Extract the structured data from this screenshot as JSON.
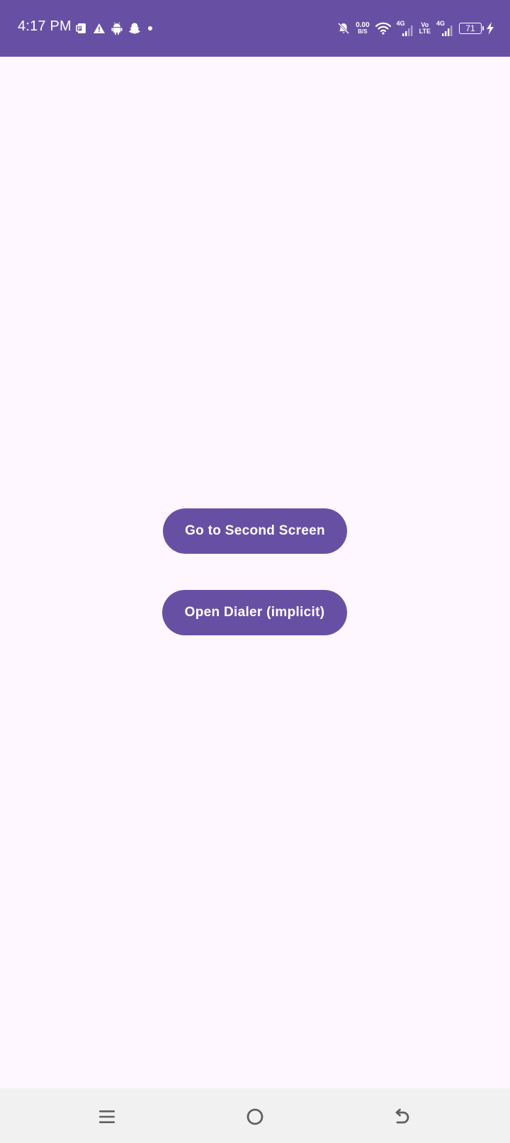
{
  "status_bar": {
    "time": "4:17 PM",
    "net_speed_value": "0.00",
    "net_speed_unit": "B/S",
    "sim1_network": "4G",
    "volte_top": "Vo",
    "volte_bottom": "LTE",
    "sim2_network": "4G",
    "battery_level": "71",
    "icons": [
      "pdf-icon",
      "warning-icon",
      "android-icon",
      "snapchat-icon",
      "dot-icon",
      "bell-off-icon",
      "wifi-icon",
      "signal-icon",
      "battery-icon",
      "charging-icon"
    ]
  },
  "main": {
    "second_screen_button": "Go to Second Screen",
    "open_dialer_button": "Open Dialer (implicit)"
  },
  "nav_bar": {
    "icons": [
      "menu-icon",
      "home-icon",
      "back-icon"
    ]
  },
  "colors": {
    "primary": "#6750a4",
    "background": "#fef7ff",
    "nav_background": "#f1f1f1"
  }
}
